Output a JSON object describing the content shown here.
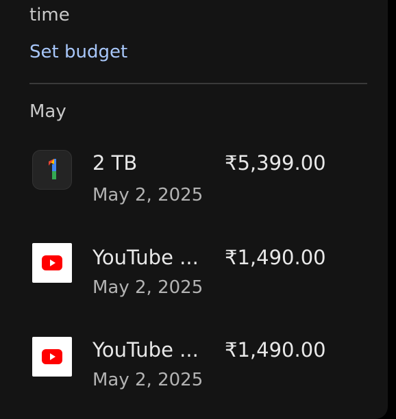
{
  "header": {
    "time_text": "time",
    "set_budget_label": "Set budget"
  },
  "history": {
    "month_label": "May",
    "items": [
      {
        "icon": "google-one-icon",
        "title": "2 TB",
        "date": "May 2, 2025",
        "amount": "₹5,399.00"
      },
      {
        "icon": "youtube-icon",
        "title": "YouTube ...",
        "date": "May 2, 2025",
        "amount": "₹1,490.00"
      },
      {
        "icon": "youtube-icon",
        "title": "YouTube ...",
        "date": "May 2, 2025",
        "amount": "₹1,490.00"
      }
    ]
  },
  "colors": {
    "background": "#141414",
    "link": "#a8c7fa",
    "youtube_red": "#ff0000"
  }
}
